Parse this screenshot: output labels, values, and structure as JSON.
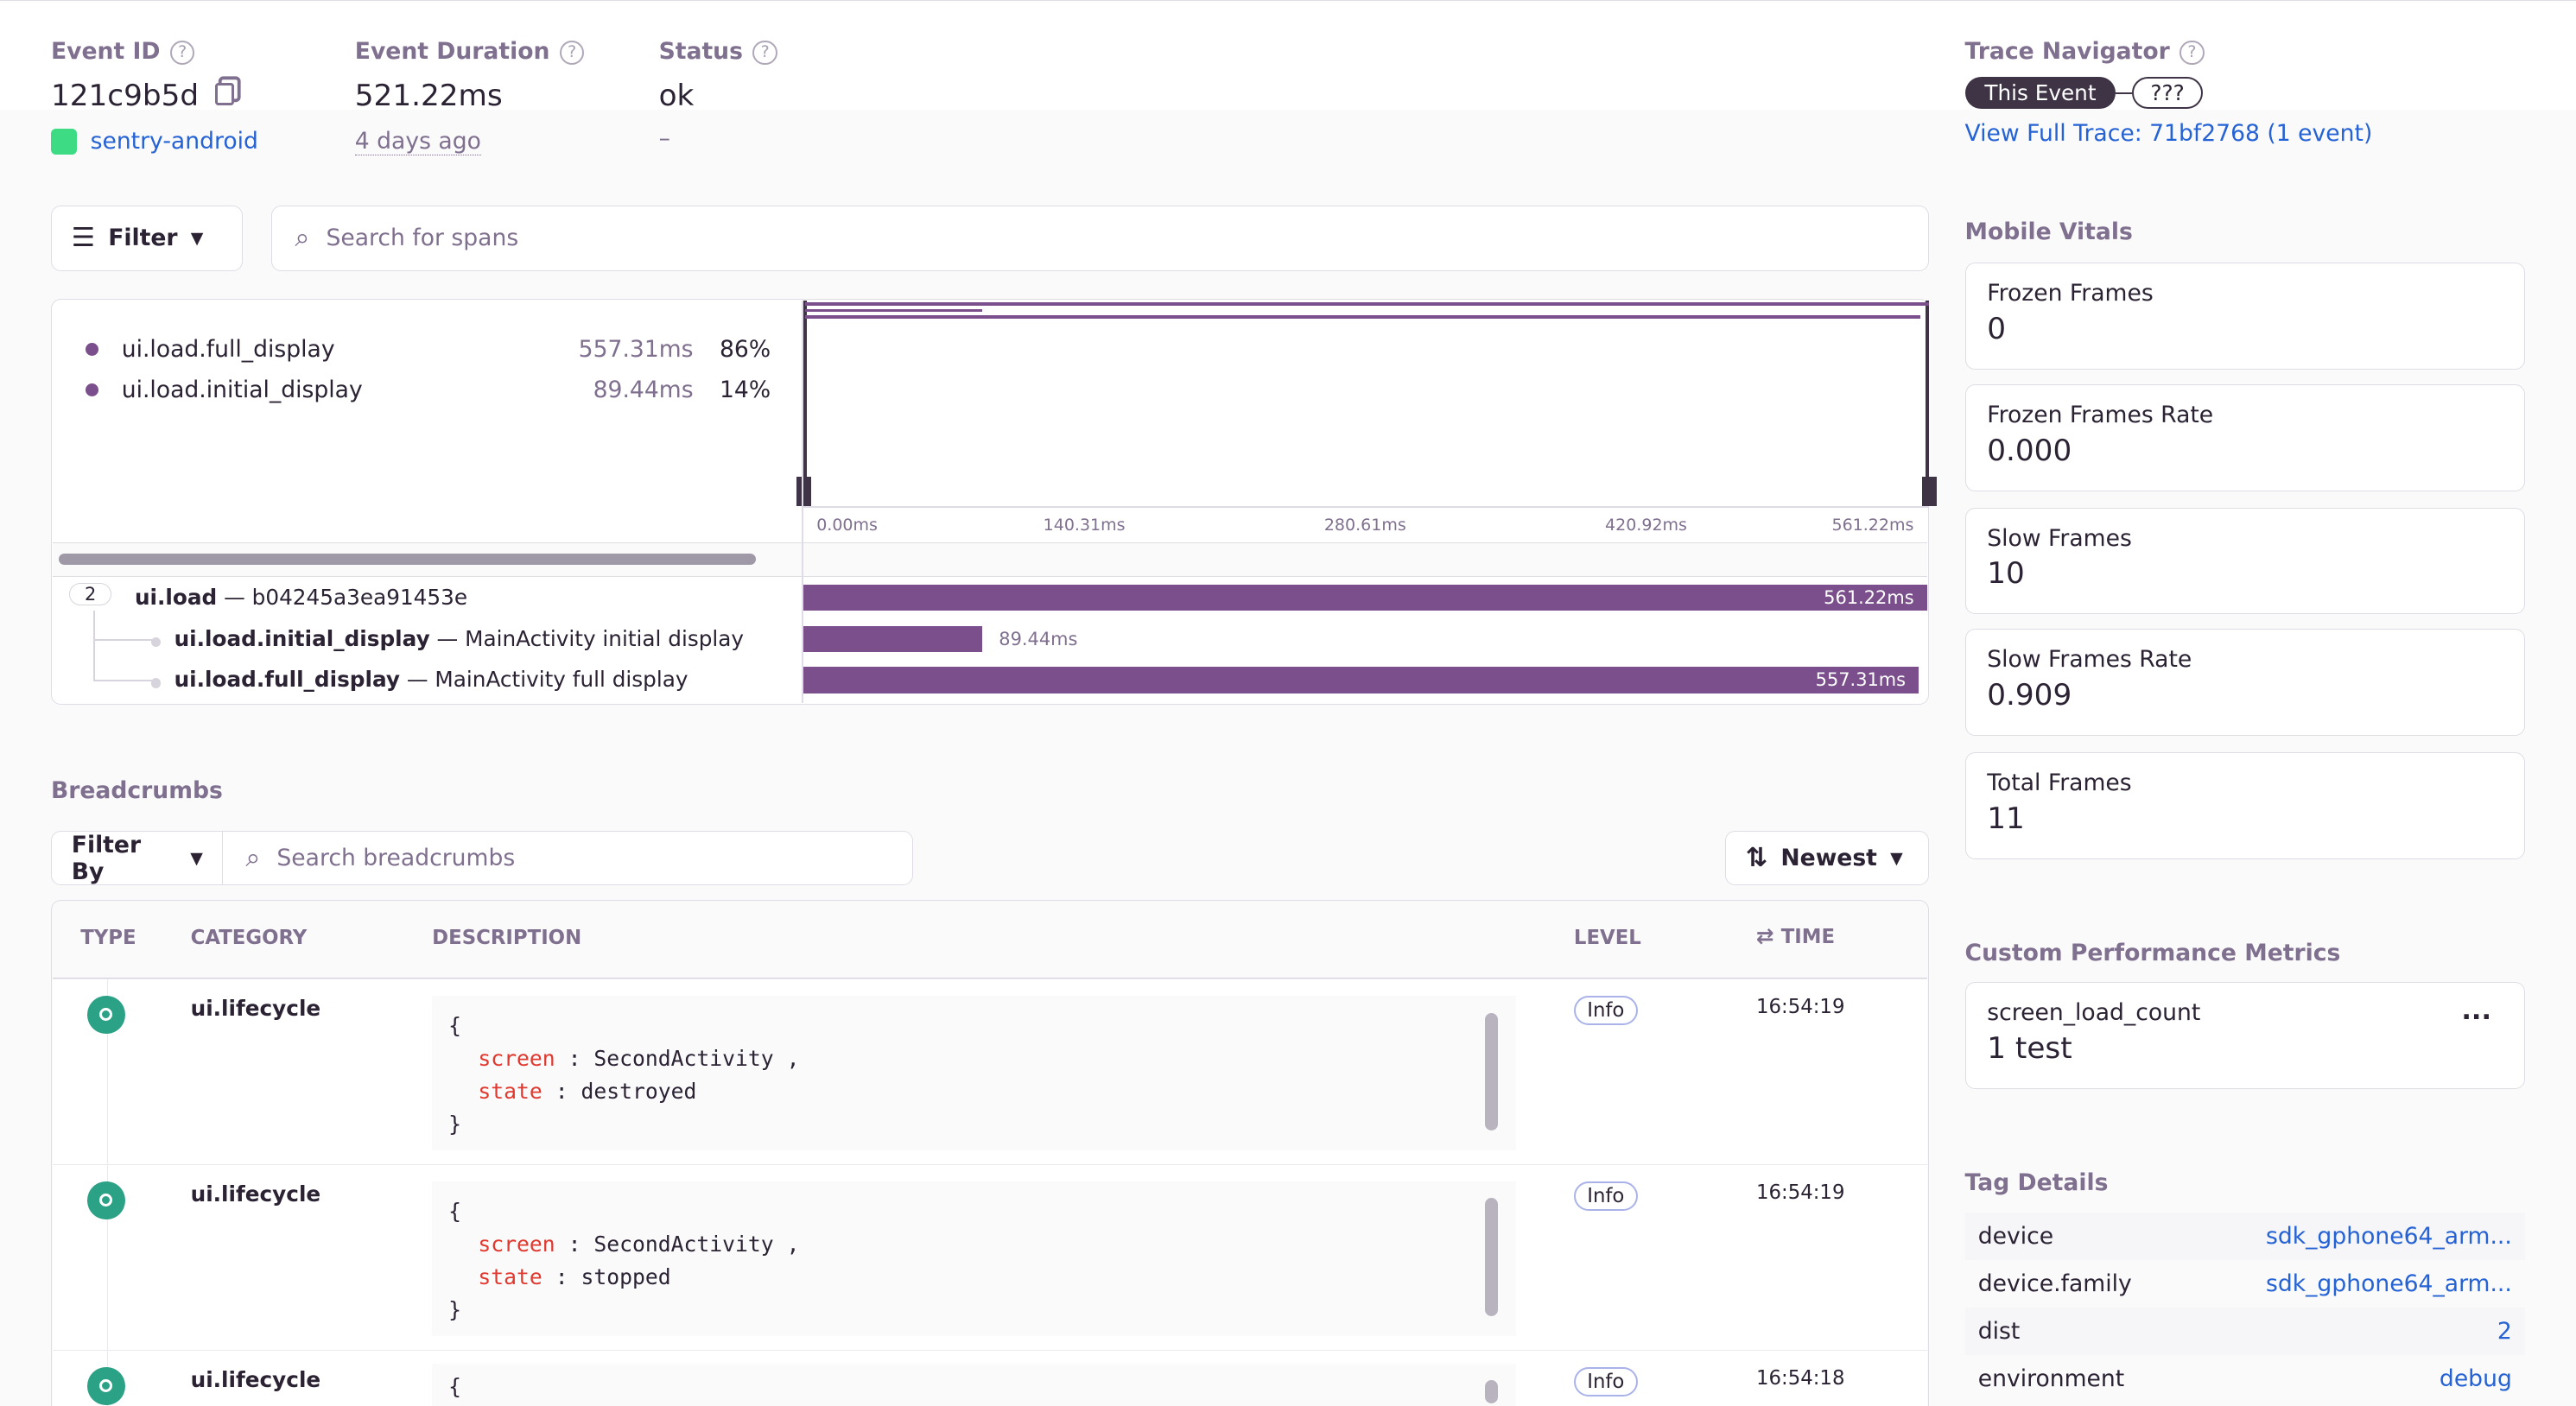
{
  "header": {
    "event_id_label": "Event ID",
    "event_id": "121c9b5d",
    "project": "sentry-android",
    "duration_label": "Event Duration",
    "duration": "521.22ms",
    "relative_time": "4 days ago",
    "status_label": "Status",
    "status": "ok",
    "status_sub": "–"
  },
  "trace": {
    "label": "Trace Navigator",
    "this_event": "This Event",
    "unknown": "???",
    "view_full": "View Full Trace: 71bf2768 (1 event)"
  },
  "spans": {
    "filter_label": "Filter",
    "search_placeholder": "Search for spans",
    "ops": [
      {
        "name": "ui.load.full_display",
        "duration": "557.31ms",
        "percent": "86%"
      },
      {
        "name": "ui.load.initial_display",
        "duration": "89.44ms",
        "percent": "14%"
      }
    ],
    "ticks": [
      "0.00ms",
      "140.31ms",
      "280.61ms",
      "420.92ms",
      "561.22ms"
    ],
    "total_ms": 561.22,
    "rows": [
      {
        "count": "2",
        "op": "ui.load",
        "desc": " — b04245a3ea91453e",
        "duration": "561.22ms",
        "ms": 561.22
      },
      {
        "op": "ui.load.initial_display",
        "desc": " — MainActivity initial display",
        "duration": "89.44ms",
        "ms": 89.44
      },
      {
        "op": "ui.load.full_display",
        "desc": " — MainActivity full display",
        "duration": "557.31ms",
        "ms": 557.31
      }
    ],
    "bar_color": "#7b4f8c"
  },
  "breadcrumbs": {
    "title": "Breadcrumbs",
    "filter_label": "Filter By",
    "search_placeholder": "Search breadcrumbs",
    "sort_label": "Newest",
    "columns": {
      "type": "TYPE",
      "category": "CATEGORY",
      "description": "DESCRIPTION",
      "level": "LEVEL",
      "time": "TIME"
    },
    "rows": [
      {
        "category": "ui.lifecycle",
        "screen": "SecondActivity",
        "state": "destroyed",
        "level": "Info",
        "time": "16:54:19"
      },
      {
        "category": "ui.lifecycle",
        "screen": "SecondActivity",
        "state": "stopped",
        "level": "Info",
        "time": "16:54:19"
      },
      {
        "category": "ui.lifecycle",
        "level": "Info",
        "time": "16:54:18"
      }
    ],
    "code": {
      "open": "{",
      "close": "}",
      "screen_key": "screen",
      "state_key": "state",
      "sep": " :  ",
      "comma": " ,"
    }
  },
  "vitals": {
    "title": "Mobile Vitals",
    "items": [
      {
        "label": "Frozen Frames",
        "value": "0"
      },
      {
        "label": "Frozen Frames Rate",
        "value": "0.000"
      },
      {
        "label": "Slow Frames",
        "value": "10"
      },
      {
        "label": "Slow Frames Rate",
        "value": "0.909"
      },
      {
        "label": "Total Frames",
        "value": "11"
      }
    ]
  },
  "custom_metrics": {
    "title": "Custom Performance Metrics",
    "name": "screen_load_count",
    "value": "1 test",
    "more": "..."
  },
  "tags": {
    "title": "Tag Details",
    "items": [
      {
        "key": "device",
        "value": "sdk_gphone64_arm..."
      },
      {
        "key": "device.family",
        "value": "sdk_gphone64_arm..."
      },
      {
        "key": "dist",
        "value": "2"
      },
      {
        "key": "environment",
        "value": "debug"
      }
    ]
  }
}
